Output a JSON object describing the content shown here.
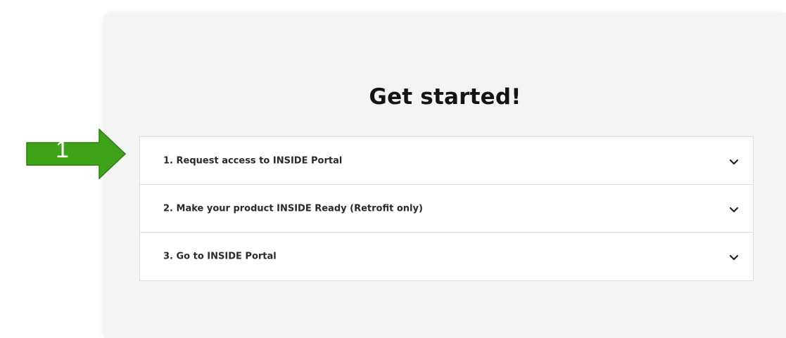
{
  "annotation": {
    "number": "1",
    "color": "#3fa31a"
  },
  "section": {
    "title": "Get started!"
  },
  "accordion": {
    "items": [
      {
        "label": "1. Request access to INSIDE Portal",
        "icon": "chevron-down-icon",
        "expanded": false
      },
      {
        "label": "2. Make your product INSIDE Ready (Retrofit only)",
        "icon": "chevron-down-icon",
        "expanded": false
      },
      {
        "label": "3. Go to INSIDE Portal",
        "icon": "chevron-down-icon",
        "expanded": false
      }
    ]
  }
}
